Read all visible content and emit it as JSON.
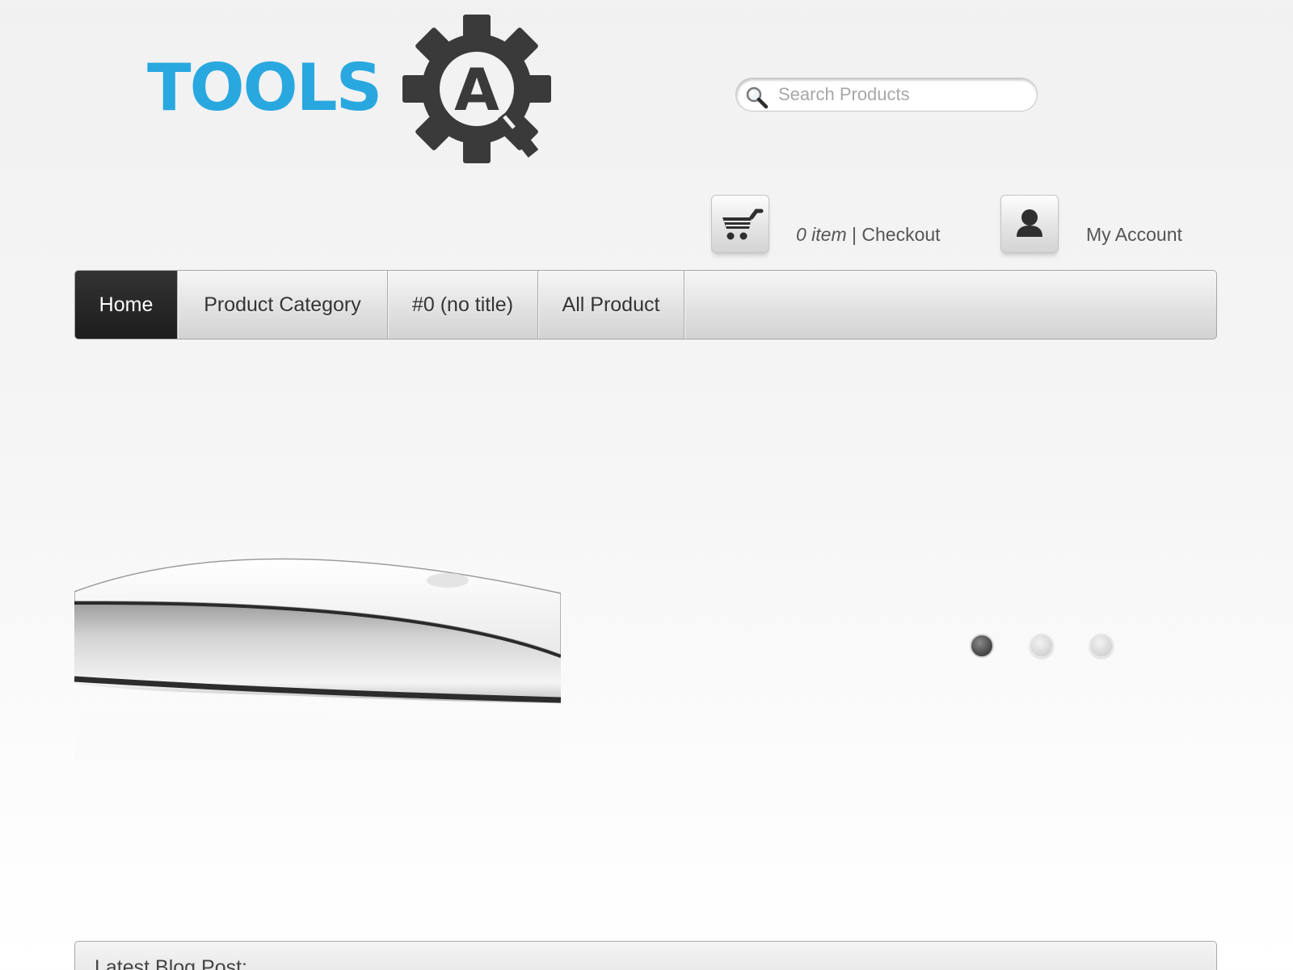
{
  "header": {
    "logo": {
      "wordmark": "TOOLS",
      "badge_letter": "A",
      "wordmark_color": "#29a8e0",
      "gear_color": "#3a3a3a"
    },
    "search": {
      "placeholder": "Search Products",
      "value": "",
      "icon": "search-icon"
    },
    "cart": {
      "icon": "shopping-cart-icon",
      "count_text": "0 item",
      "separator": " | ",
      "checkout_label": "Checkout"
    },
    "account": {
      "icon": "user-icon",
      "label": "My Account"
    }
  },
  "nav": {
    "items": [
      {
        "label": "Home",
        "active": true
      },
      {
        "label": "Product Category",
        "active": false
      },
      {
        "label": "#0 (no title)",
        "active": false
      },
      {
        "label": "All Product",
        "active": false
      }
    ]
  },
  "slider": {
    "image": "magic-mouse-image",
    "total_slides": 3,
    "active_slide": 1
  },
  "blog": {
    "title": "Latest Blog Post:"
  },
  "colors": {
    "nav_active_bg": "#222222",
    "nav_active_text": "#ffffff",
    "page_bg": "#f3f3f3"
  }
}
